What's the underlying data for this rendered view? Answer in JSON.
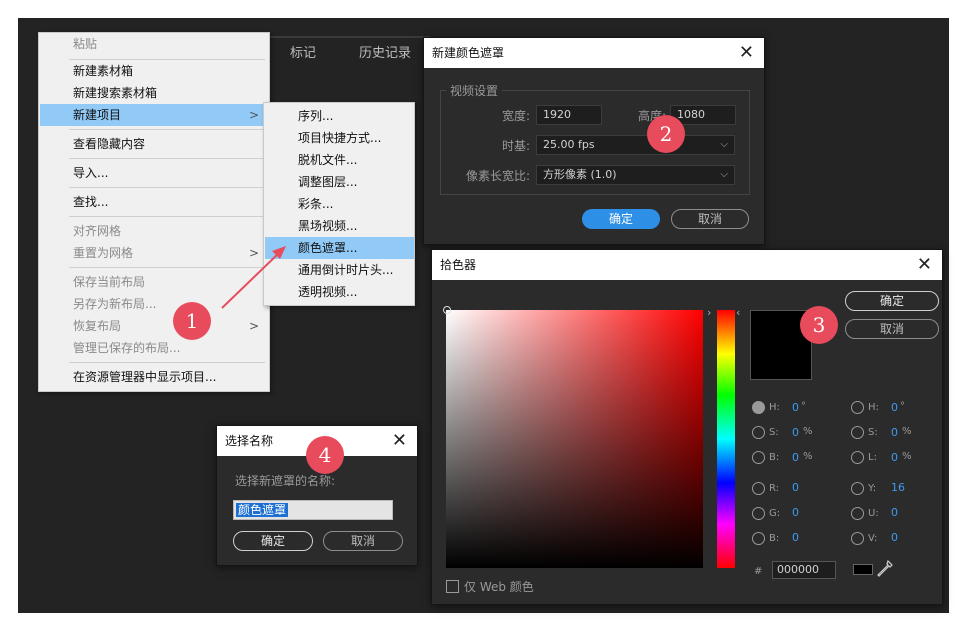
{
  "panel_tabs": [
    "标记",
    "历史记录"
  ],
  "context_menu": {
    "items": [
      {
        "label": "粘贴",
        "disabled": true
      },
      {
        "label": "新建素材箱"
      },
      {
        "label": "新建搜索素材箱"
      },
      {
        "label": "新建项目",
        "submenu": true,
        "active": true
      },
      {
        "label": "查看隐藏内容"
      },
      {
        "label": "导入..."
      },
      {
        "label": "查找..."
      },
      {
        "label": "对齐网格",
        "disabled": true
      },
      {
        "label": "重置为网格",
        "disabled": true,
        "submenu": true
      },
      {
        "label": "保存当前布局",
        "disabled": true
      },
      {
        "label": "另存为新布局...",
        "disabled": true
      },
      {
        "label": "恢复布局",
        "disabled": true,
        "submenu": true
      },
      {
        "label": "管理已保存的布局...",
        "disabled": true
      },
      {
        "label": "在资源管理器中显示项目..."
      }
    ],
    "arrow_glyph": ">"
  },
  "submenu": {
    "items": [
      "序列...",
      "项目快捷方式...",
      "脱机文件...",
      "调整图层...",
      "彩条...",
      "黑场视频...",
      "颜色遮罩...",
      "通用倒计时片头...",
      "透明视频..."
    ],
    "active_index": 6
  },
  "color_matte_dialog": {
    "title": "新建颜色遮罩",
    "close_glyph": "✕",
    "group_label": "视频设置",
    "width_label": "宽度:",
    "width_value": "1920",
    "height_label": "高度:",
    "height_value": "1080",
    "timebase_label": "时基:",
    "timebase_value": "25.00 fps",
    "pixel_aspect_label": "像素长宽比:",
    "pixel_aspect_value": "方形像素 (1.0)",
    "ok_label": "确定",
    "cancel_label": "取消"
  },
  "color_picker": {
    "title": "拾色器",
    "close_glyph": "✕",
    "ok_label": "确定",
    "cancel_label": "取消",
    "left_column": [
      {
        "label": "H:",
        "value": "0",
        "unit": "°",
        "checked": true
      },
      {
        "label": "S:",
        "value": "0",
        "unit": "%"
      },
      {
        "label": "B:",
        "value": "0",
        "unit": "%"
      },
      {
        "label": "R:",
        "value": "0",
        "unit": ""
      },
      {
        "label": "G:",
        "value": "0",
        "unit": ""
      },
      {
        "label": "B:",
        "value": "0",
        "unit": ""
      }
    ],
    "right_column": [
      {
        "label": "H:",
        "value": "0",
        "unit": "°"
      },
      {
        "label": "S:",
        "value": "0",
        "unit": "%"
      },
      {
        "label": "L:",
        "value": "0",
        "unit": "%"
      },
      {
        "label": "Y:",
        "value": "16",
        "unit": ""
      },
      {
        "label": "U:",
        "value": "0",
        "unit": ""
      },
      {
        "label": "V:",
        "value": "0",
        "unit": ""
      }
    ],
    "hex_prefix": "#",
    "hex_value": "000000",
    "web_colors_label": "仅 Web 颜色",
    "selected_color": "#000000"
  },
  "name_dialog": {
    "title": "选择名称",
    "close_glyph": "✕",
    "prompt": "选择新遮罩的名称:",
    "name_value": "颜色遮罩",
    "ok_label": "确定",
    "cancel_label": "取消"
  },
  "steps": [
    "1",
    "2",
    "3",
    "4"
  ],
  "colors": {
    "accent_blue": "#2e8fe6",
    "menu_highlight": "#91c9f7",
    "step_badge": "#e84b5b",
    "value_blue": "#3d9bf0"
  }
}
